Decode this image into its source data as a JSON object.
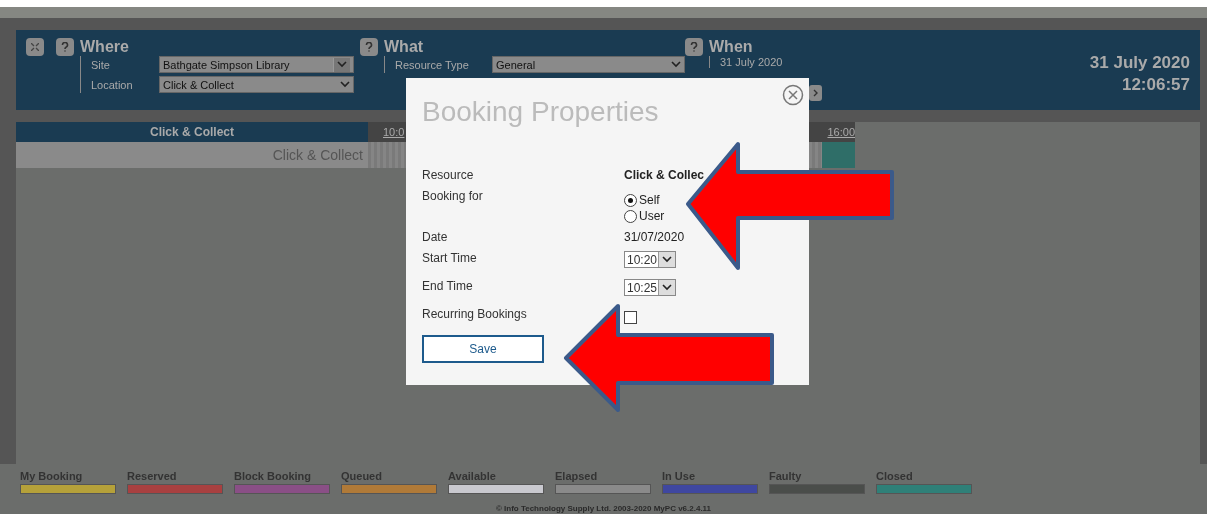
{
  "header": {
    "where": {
      "title": "Where",
      "fields": [
        {
          "label": "Site",
          "value": "Bathgate Simpson Library",
          "kind": "boxed"
        },
        {
          "label": "Location",
          "value": "Click & Collect",
          "kind": "plain"
        }
      ]
    },
    "what": {
      "title": "What",
      "fields": [
        {
          "label": "Resource Type",
          "value": "General"
        }
      ]
    },
    "when": {
      "title": "When",
      "date": "31 July 2020"
    },
    "clock": {
      "date": "31 July 2020",
      "time": "12:06:57"
    }
  },
  "grid": {
    "resource_header": "Click & Collect",
    "times": [
      "10:0",
      "16:00"
    ],
    "rows": [
      {
        "name": "Click & Collect"
      }
    ]
  },
  "dialog": {
    "title": "Booking Properties",
    "rows": [
      {
        "kind": "text",
        "label": "Resource",
        "value": "Click & Collec",
        "bold": true
      },
      {
        "kind": "radio",
        "label": "Booking for",
        "options": [
          {
            "label": "Self",
            "selected": true
          },
          {
            "label": "User",
            "selected": false
          }
        ]
      },
      {
        "kind": "text",
        "label": "Date",
        "value": "31/07/2020",
        "bold": false
      },
      {
        "kind": "select",
        "label": "Start Time",
        "value": "10:20"
      },
      {
        "kind": "select",
        "label": "End Time",
        "value": "10:25"
      },
      {
        "kind": "checkbox",
        "label": "Recurring Bookings",
        "checked": false
      }
    ],
    "button": "Save"
  },
  "legend": [
    {
      "label": "My Booking",
      "color": "#b5a13a"
    },
    {
      "label": "Reserved",
      "color": "#a84040"
    },
    {
      "label": "Block Booking",
      "color": "#8a4f86"
    },
    {
      "label": "Queued",
      "color": "#b07a38"
    },
    {
      "label": "Available",
      "color": "#c9c9cf"
    },
    {
      "label": "Elapsed",
      "color": "#8a8a8a"
    },
    {
      "label": "In Use",
      "color": "#3f47a0"
    },
    {
      "label": "Faulty",
      "color": "#4a4d4a"
    },
    {
      "label": "Closed",
      "color": "#2f8078"
    }
  ],
  "footer": "© Info Technology Supply Ltd. 2003-2020 MyPC v6.2.4.11"
}
